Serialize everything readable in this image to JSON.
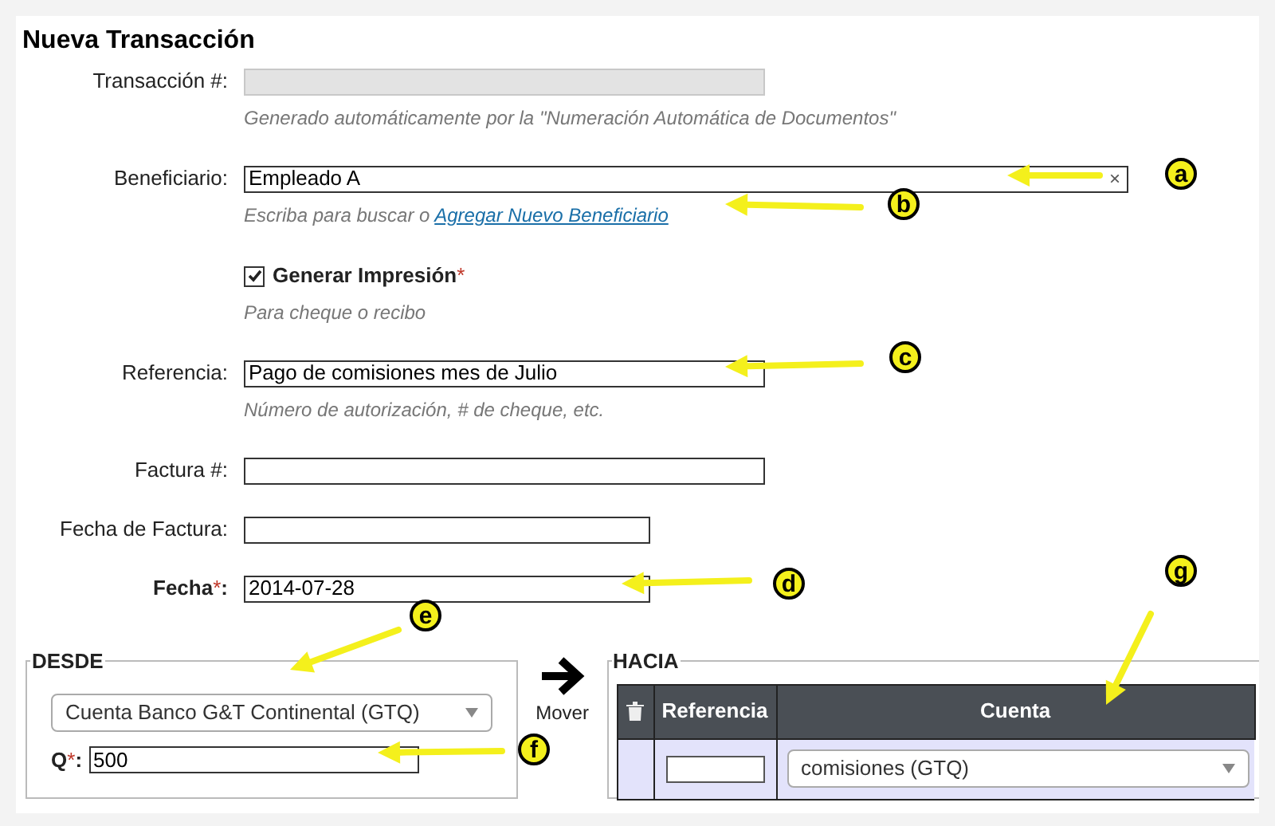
{
  "title": "Nueva Transacción",
  "fields": [
    {
      "kind": "text",
      "label": "Transacción #:",
      "disabled": true,
      "hint": "Generado automáticamente por la \"Numeración Automática de Documentos\""
    },
    {
      "kind": "combo",
      "label": "Beneficiario:",
      "value": "Empleado A",
      "clear": "×",
      "hint": "Escriba para buscar o",
      "link": "Agregar Nuevo Beneficiario"
    },
    {
      "kind": "checkbox",
      "label": "Generar Impresión",
      "required_mark": "*",
      "checked": true,
      "hint": "Para cheque o recibo"
    },
    {
      "kind": "text",
      "label": "Referencia:",
      "value": "Pago de comisiones mes de Julio",
      "hint": "Número de autorización, # de cheque, etc."
    },
    {
      "kind": "text",
      "label": "Factura #:"
    },
    {
      "kind": "date",
      "label": "Fecha de Factura:"
    },
    {
      "kind": "date",
      "label": "Fecha",
      "required_mark": "*",
      "label_end": ":",
      "value": "2014-07-28"
    }
  ],
  "desde": {
    "legend": "DESDE",
    "account": "Cuenta Banco G&T Continental (GTQ)",
    "amount": {
      "label": "Q",
      "required_mark": "*",
      "label_end": ":",
      "value": "500"
    }
  },
  "move": {
    "label": "Mover"
  },
  "hacia": {
    "legend": "HACIA",
    "columns": [
      "Referencia",
      "Cuenta"
    ],
    "rows": [
      {
        "cuenta": "comisiones (GTQ)"
      }
    ]
  },
  "annotations": [
    {
      "letter": "a"
    },
    {
      "letter": "b"
    },
    {
      "letter": "c"
    },
    {
      "letter": "d"
    },
    {
      "letter": "e"
    },
    {
      "letter": "f"
    },
    {
      "letter": "g"
    }
  ]
}
